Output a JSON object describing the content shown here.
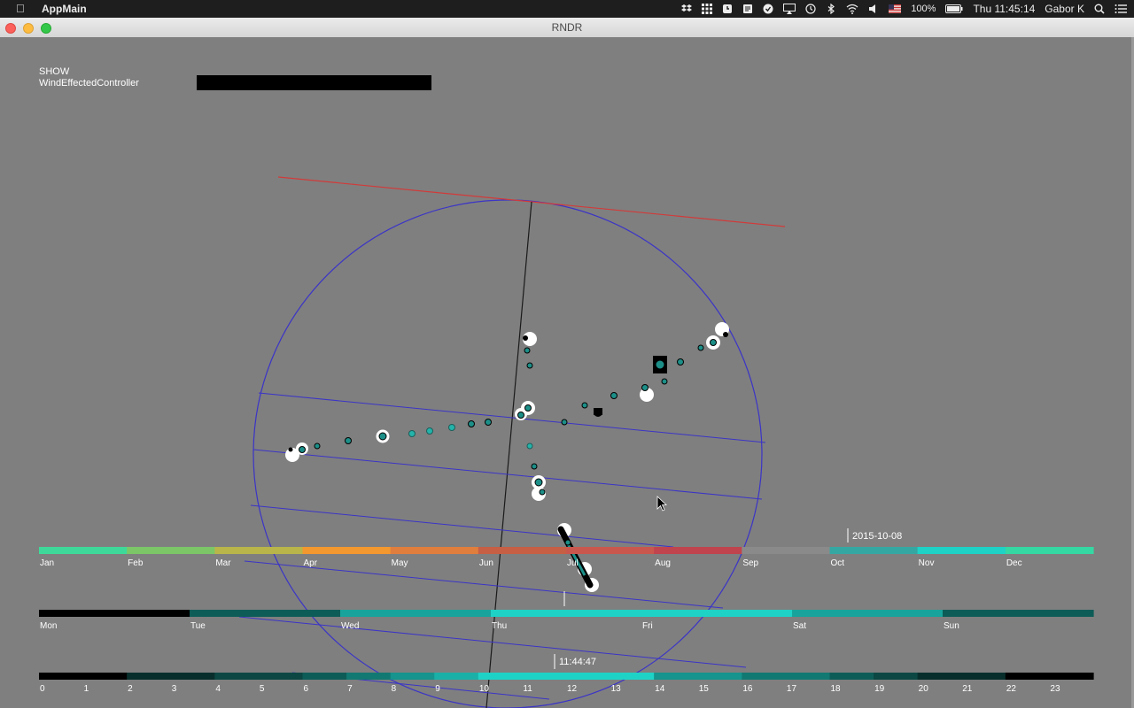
{
  "menubar": {
    "app_name": "AppMain",
    "battery": "100%",
    "clock": "Thu 11:45:14",
    "user": "Gabor K"
  },
  "window": {
    "title": "RNDR"
  },
  "controls": {
    "show_label": "SHOW",
    "controller_label": "WindEffectedController"
  },
  "timeline_month": {
    "labels": [
      "Jan",
      "Feb",
      "Mar",
      "Apr",
      "May",
      "Jun",
      "Jul",
      "Aug",
      "Sep",
      "Oct",
      "Nov",
      "Dec"
    ],
    "colors": [
      "#3ed99a",
      "#7cc668",
      "#b9b54a",
      "#f3972f",
      "#e07e3e",
      "#c65f44",
      "#c9574e",
      "#c0444e",
      "#8a8a8a",
      "#35a7a3",
      "#1fd2c6",
      "#35d7a3"
    ],
    "marker_label": "2015-10-08"
  },
  "timeline_week": {
    "labels": [
      "Mon",
      "Tue",
      "Wed",
      "Thu",
      "Fri",
      "Sat",
      "Sun"
    ],
    "colors": [
      "#000000",
      "#0e5c57",
      "#18a49c",
      "#1fd2c6",
      "#1fd2c6",
      "#18a49c",
      "#0e5c57"
    ]
  },
  "timeline_hour": {
    "labels": [
      "0",
      "1",
      "2",
      "3",
      "4",
      "5",
      "6",
      "7",
      "8",
      "9",
      "10",
      "11",
      "12",
      "13",
      "14",
      "15",
      "16",
      "17",
      "18",
      "19",
      "20",
      "21",
      "22",
      "23"
    ],
    "colors": [
      "#000000",
      "#000000",
      "#082e2c",
      "#082e2c",
      "#0c4744",
      "#0c4744",
      "#0e5c57",
      "#127872",
      "#16948d",
      "#1ab0a8",
      "#1fd2c6",
      "#1fd2c6",
      "#1fd2c6",
      "#1fd2c6",
      "#16948d",
      "#16948d",
      "#127872",
      "#127872",
      "#0e5c57",
      "#0c4744",
      "#082e2c",
      "#082e2c",
      "#000000",
      "#000000"
    ],
    "marker_label": "11:44:47"
  }
}
